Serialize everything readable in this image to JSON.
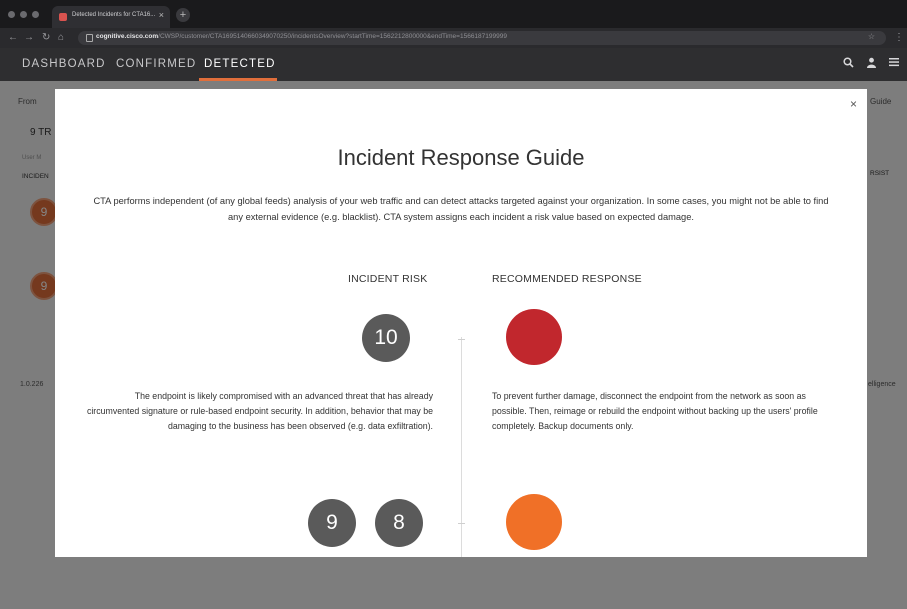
{
  "browser": {
    "tab_title": "Detected Incidents for CTA16...",
    "tab_close": "×",
    "new_tab": "+",
    "url_host": "cognitive.cisco.com",
    "url_path": "/CWSP/customer/CTA1695140660349070250/incidentsOverview?startTime=1562212800000&endTime=1566187199999"
  },
  "app": {
    "nav": [
      "DASHBOARD",
      "CONFIRMED",
      "DETECTED"
    ],
    "active_nav": "DETECTED",
    "accent": "#e06e3b"
  },
  "background": {
    "from_label": "From",
    "count_label": "9 TR",
    "user_label": "User M",
    "incident_label": "INCIDEN",
    "guide_label": "Guide",
    "persist_label": "RSIST",
    "version": "1.0.226",
    "intelligence": "elligence",
    "circles": [
      "9",
      "9"
    ]
  },
  "modal": {
    "close": "×",
    "title": "Incident Response Guide",
    "intro": "CTA performs independent (of any global feeds) analysis of your web traffic and can detect attacks targeted against your organization. In some cases, you might not be able to find any external evidence (e.g. blacklist). CTA system assigns each incident a risk value based on expected damage.",
    "col_risk": "INCIDENT RISK",
    "col_response": "RECOMMENDED RESPONSE",
    "levels": [
      {
        "risks": [
          "10"
        ],
        "color": "#c1272d",
        "risk_desc": "The endpoint is likely compromised with an advanced threat that has already circumvented signature or rule-based endpoint security. In addition, behavior that may be damaging to the business has been observed (e.g. data exfiltration).",
        "response_desc": "To prevent further damage, disconnect the endpoint from the network as soon as possible. Then, reimage or rebuild the endpoint without backing up the users' profile completely. Backup documents only."
      },
      {
        "risks": [
          "9",
          "8"
        ],
        "color": "#f07027"
      }
    ]
  }
}
